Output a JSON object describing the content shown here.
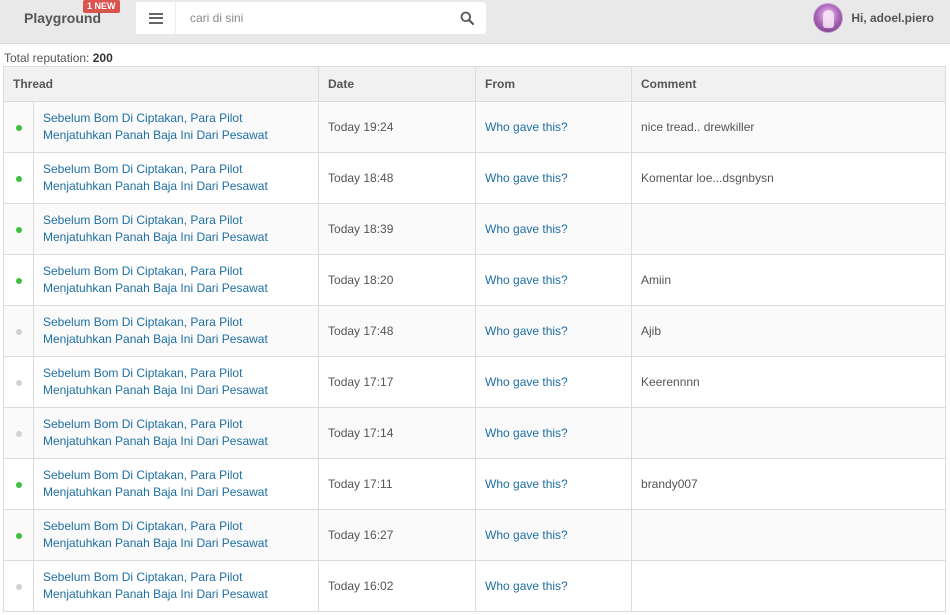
{
  "header": {
    "brand": "Playground",
    "badge": "1 NEW",
    "search_placeholder": "cari di sini",
    "greeting": "Hi, adoel.piero"
  },
  "reputation": {
    "label": "Total reputation:",
    "value": "200"
  },
  "table": {
    "columns": [
      "Thread",
      "Date",
      "From",
      "Comment"
    ],
    "rows": [
      {
        "status": "on",
        "thread": "Sebelum Bom Di Ciptakan, Para Pilot Menjatuhkan Panah Baja Ini Dari Pesawat",
        "date": "Today 19:24",
        "from": "Who gave this?",
        "comment": "nice tread.. drewkiller"
      },
      {
        "status": "on",
        "thread": "Sebelum Bom Di Ciptakan, Para Pilot Menjatuhkan Panah Baja Ini Dari Pesawat",
        "date": "Today 18:48",
        "from": "Who gave this?",
        "comment": "Komentar loe...dsgnbysn"
      },
      {
        "status": "on",
        "thread": "Sebelum Bom Di Ciptakan, Para Pilot Menjatuhkan Panah Baja Ini Dari Pesawat",
        "date": "Today 18:39",
        "from": "Who gave this?",
        "comment": ""
      },
      {
        "status": "on",
        "thread": "Sebelum Bom Di Ciptakan, Para Pilot Menjatuhkan Panah Baja Ini Dari Pesawat",
        "date": "Today 18:20",
        "from": "Who gave this?",
        "comment": "Amiin"
      },
      {
        "status": "off",
        "thread": "Sebelum Bom Di Ciptakan, Para Pilot Menjatuhkan Panah Baja Ini Dari Pesawat",
        "date": "Today 17:48",
        "from": "Who gave this?",
        "comment": "Ajib"
      },
      {
        "status": "off",
        "thread": "Sebelum Bom Di Ciptakan, Para Pilot Menjatuhkan Panah Baja Ini Dari Pesawat",
        "date": "Today 17:17",
        "from": "Who gave this?",
        "comment": "Keerennnn"
      },
      {
        "status": "off",
        "thread": "Sebelum Bom Di Ciptakan, Para Pilot Menjatuhkan Panah Baja Ini Dari Pesawat",
        "date": "Today 17:14",
        "from": "Who gave this?",
        "comment": ""
      },
      {
        "status": "on",
        "thread": "Sebelum Bom Di Ciptakan, Para Pilot Menjatuhkan Panah Baja Ini Dari Pesawat",
        "date": "Today 17:11",
        "from": "Who gave this?",
        "comment": "brandy007"
      },
      {
        "status": "on",
        "thread": "Sebelum Bom Di Ciptakan, Para Pilot Menjatuhkan Panah Baja Ini Dari Pesawat",
        "date": "Today 16:27",
        "from": "Who gave this?",
        "comment": ""
      },
      {
        "status": "off",
        "thread": "Sebelum Bom Di Ciptakan, Para Pilot Menjatuhkan Panah Baja Ini Dari Pesawat",
        "date": "Today 16:02",
        "from": "Who gave this?",
        "comment": ""
      }
    ]
  },
  "icons": {
    "menu": "hamburger-menu-icon",
    "search": "search-icon",
    "status_on": "green-dot",
    "status_off": "gray-dot"
  },
  "colors": {
    "link": "#1e6fa3",
    "status_on": "#3fbf3f",
    "status_off": "#d2d2d2",
    "badge": "#d9534f"
  }
}
